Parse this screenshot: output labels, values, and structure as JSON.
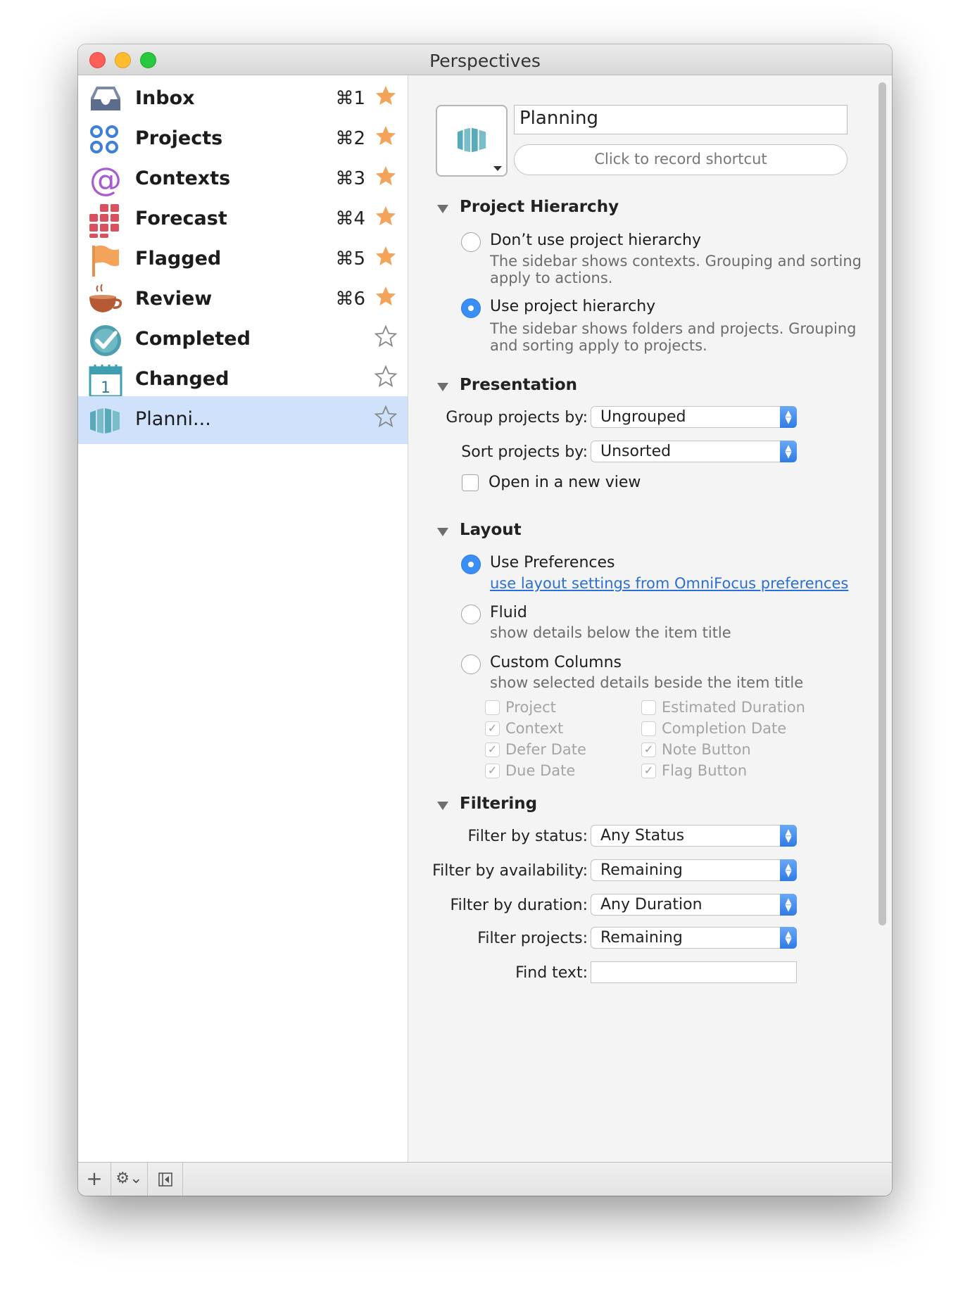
{
  "window": {
    "title": "Perspectives"
  },
  "colors": {
    "selection": "#cfe1fb",
    "accent": "#3b8ef6",
    "star": "#f3a35a",
    "link": "#2b6fd4"
  },
  "sidebar": {
    "items": [
      {
        "label": "Inbox",
        "shortcut": "⌘1",
        "icon": "inbox-tray-icon",
        "starred": true
      },
      {
        "label": "Projects",
        "shortcut": "⌘2",
        "icon": "projects-circles-icon",
        "starred": true
      },
      {
        "label": "Contexts",
        "shortcut": "⌘3",
        "icon": "at-sign-icon",
        "starred": true
      },
      {
        "label": "Forecast",
        "shortcut": "⌘4",
        "icon": "forecast-grid-icon",
        "starred": true
      },
      {
        "label": "Flagged",
        "shortcut": "⌘5",
        "icon": "flag-icon",
        "starred": true
      },
      {
        "label": "Review",
        "shortcut": "⌘6",
        "icon": "coffee-cup-icon",
        "starred": true
      },
      {
        "label": "Completed",
        "shortcut": "",
        "icon": "checkmark-circle-icon",
        "starred": false
      },
      {
        "label": "Changed",
        "shortcut": "",
        "icon": "calendar-icon",
        "starred": false
      },
      {
        "label": "Planni...",
        "shortcut": "",
        "icon": "planning-columns-icon",
        "starred": false,
        "selected": true
      }
    ]
  },
  "detail": {
    "name_value": "Planning",
    "shortcut_button": "Click to record shortcut",
    "project_hierarchy": {
      "title": "Project Hierarchy",
      "option1": {
        "label": "Don’t use project hierarchy",
        "desc1": "The sidebar shows contexts. Grouping and sorting",
        "desc2": "apply to actions.",
        "selected": false
      },
      "option2": {
        "label": "Use project hierarchy",
        "desc1": "The sidebar shows folders and projects. Grouping",
        "desc2": "and sorting apply to projects.",
        "selected": true
      }
    },
    "presentation": {
      "title": "Presentation",
      "group_label": "Group projects by:",
      "group_value": "Ungrouped",
      "sort_label": "Sort projects by:",
      "sort_value": "Unsorted",
      "open_new_view": "Open in a new view"
    },
    "layout": {
      "title": "Layout",
      "use_prefs": "Use Preferences",
      "use_prefs_link": "use layout settings from OmniFocus preferences",
      "fluid": "Fluid",
      "fluid_desc": "show details below the item title",
      "custom": "Custom Columns",
      "custom_desc": "show selected details beside the item title",
      "columns": [
        {
          "label": "Project",
          "checked": false
        },
        {
          "label": "Estimated Duration",
          "checked": false
        },
        {
          "label": "Context",
          "checked": true
        },
        {
          "label": "Completion Date",
          "checked": false
        },
        {
          "label": "Defer Date",
          "checked": true
        },
        {
          "label": "Note Button",
          "checked": true
        },
        {
          "label": "Due Date",
          "checked": true
        },
        {
          "label": "Flag Button",
          "checked": true
        }
      ]
    },
    "filtering": {
      "title": "Filtering",
      "status_label": "Filter by status:",
      "status_value": "Any Status",
      "availability_label": "Filter by availability:",
      "availability_value": "Remaining",
      "duration_label": "Filter by duration:",
      "duration_value": "Any Duration",
      "projects_label": "Filter projects:",
      "projects_value": "Remaining",
      "find_label": "Find text:",
      "find_value": ""
    }
  },
  "toolbar": {
    "add": "+",
    "gear": "⚙⌄",
    "collapse_icon": "sidebar-collapse-icon"
  }
}
